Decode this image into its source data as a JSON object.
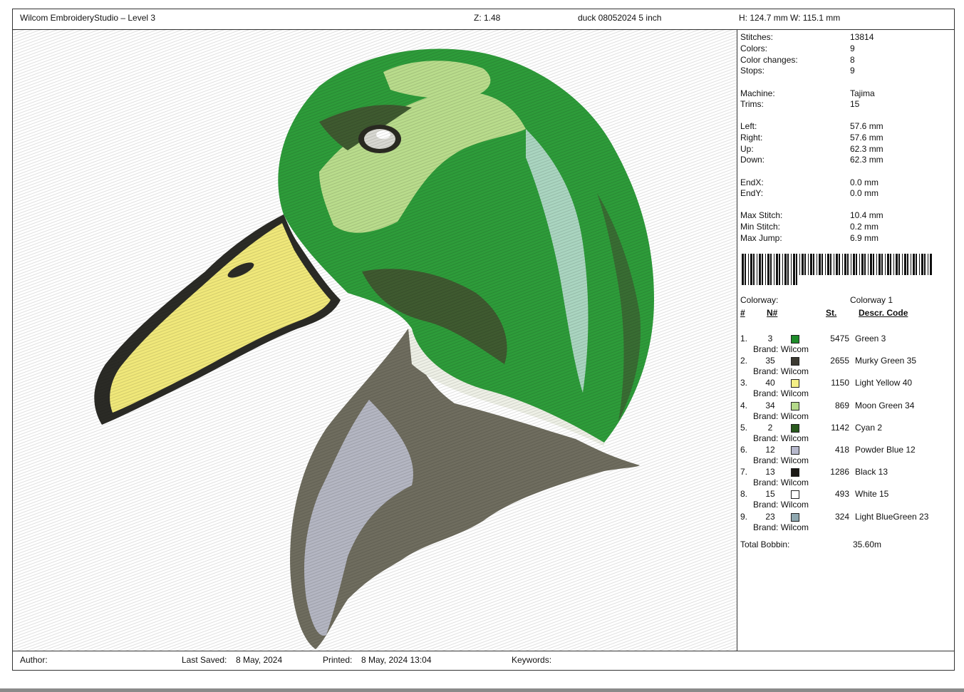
{
  "header": {
    "app": "Wilcom EmbroideryStudio – Level 3",
    "zoom": "Z: 1.48",
    "design": "duck 08052024 5 inch",
    "size": "H: 124.7 mm   W: 115.1 mm"
  },
  "stats": [
    {
      "k": "Stitches:",
      "v": "13814"
    },
    {
      "k": "Colors:",
      "v": "9"
    },
    {
      "k": "Color changes:",
      "v": "8"
    },
    {
      "k": "Stops:",
      "v": "9"
    },
    {
      "k": "Machine:",
      "v": "Tajima"
    },
    {
      "k": "Trims:",
      "v": "15"
    },
    {
      "k": "Left:",
      "v": "57.6 mm"
    },
    {
      "k": "Right:",
      "v": "57.6 mm"
    },
    {
      "k": "Up:",
      "v": "62.3 mm"
    },
    {
      "k": "Down:",
      "v": "62.3 mm"
    },
    {
      "k": "EndX:",
      "v": "0.0 mm"
    },
    {
      "k": "EndY:",
      "v": "0.0 mm"
    },
    {
      "k": "Max Stitch:",
      "v": "10.4 mm"
    },
    {
      "k": "Min Stitch:",
      "v": "0.2 mm"
    },
    {
      "k": "Max Jump:",
      "v": "6.9 mm"
    }
  ],
  "colorway": {
    "k": "Colorway:",
    "v": "Colorway 1"
  },
  "columns": {
    "idx": "#",
    "num": "N#",
    "st": "St.",
    "desc": "Descr. Code"
  },
  "threads": [
    {
      "idx": "1.",
      "num": "3",
      "color": "#1e8c2a",
      "st": "5475",
      "desc": "Green 3",
      "brand": "Brand: Wilcom"
    },
    {
      "idx": "2.",
      "num": "35",
      "color": "#3c3a32",
      "st": "2655",
      "desc": "Murky Green 35",
      "brand": "Brand: Wilcom"
    },
    {
      "idx": "3.",
      "num": "40",
      "color": "#f4ef86",
      "st": "1150",
      "desc": "Light Yellow 40",
      "brand": "Brand: Wilcom"
    },
    {
      "idx": "4.",
      "num": "34",
      "color": "#b4d98a",
      "st": "869",
      "desc": "Moon Green 34",
      "brand": "Brand: Wilcom"
    },
    {
      "idx": "5.",
      "num": "2",
      "color": "#2a5a1e",
      "st": "1142",
      "desc": "Cyan 2",
      "brand": "Brand: Wilcom"
    },
    {
      "idx": "6.",
      "num": "12",
      "color": "#b6b8cc",
      "st": "418",
      "desc": "Powder Blue 12",
      "brand": "Brand: Wilcom"
    },
    {
      "idx": "7.",
      "num": "13",
      "color": "#1c1a16",
      "st": "1286",
      "desc": "Black 13",
      "brand": "Brand: Wilcom"
    },
    {
      "idx": "8.",
      "num": "15",
      "color": "#ffffff",
      "st": "493",
      "desc": "White 15",
      "brand": "Brand: Wilcom"
    },
    {
      "idx": "9.",
      "num": "23",
      "color": "#8fa8b0",
      "st": "324",
      "desc": "Light BlueGreen 23",
      "brand": "Brand: Wilcom"
    }
  ],
  "bobbin": {
    "k": "Total Bobbin:",
    "v": "35.60m"
  },
  "footer": {
    "author": "Author:",
    "saved_label": "Last Saved:",
    "saved": "8 May, 2024",
    "printed_label": "Printed:",
    "printed": "8 May, 2024 13:04",
    "keywords": "Keywords:"
  }
}
